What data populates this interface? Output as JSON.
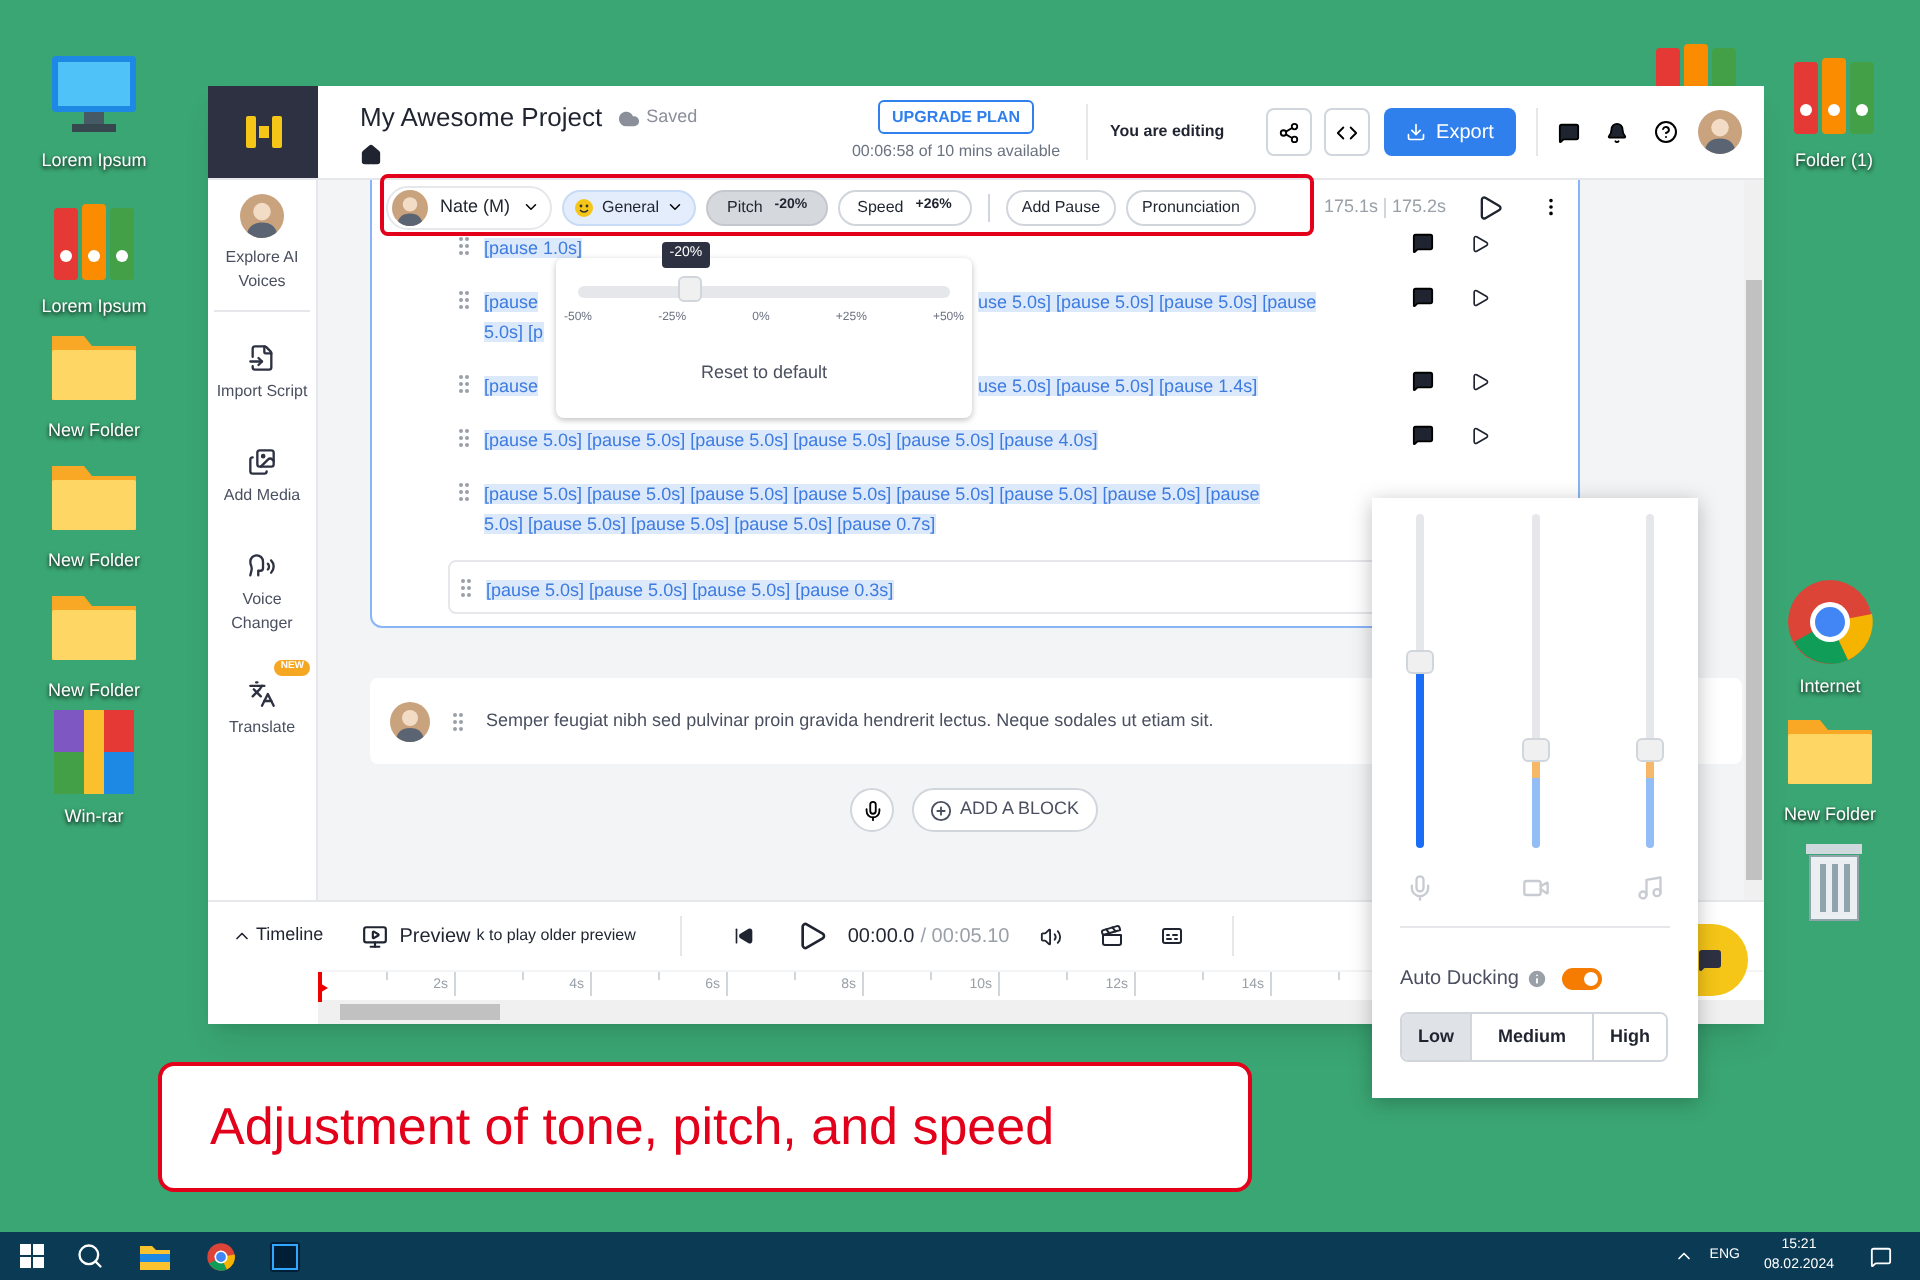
{
  "desktop_icons": [
    {
      "label": "Lorem Ipsum",
      "kind": "computer"
    },
    {
      "label": "Lorem Ipsum",
      "kind": "binders"
    },
    {
      "label": "New Folder",
      "kind": "folder"
    },
    {
      "label": "New Folder",
      "kind": "folder"
    },
    {
      "label": "New Folder",
      "kind": "folder"
    },
    {
      "label": "Win-rar",
      "kind": "archive"
    },
    {
      "kind": "binders"
    },
    {
      "label": "Folder (1)",
      "kind": "binders"
    },
    {
      "label": "Internet",
      "kind": "browser"
    },
    {
      "label": "New Folder",
      "kind": "folder"
    },
    {
      "kind": "trash"
    }
  ],
  "window": {
    "project_title": "My Awesome Project",
    "save_status": "Saved",
    "upgrade_button": "UPGRADE PLAN",
    "usage": "00:06:58 of 10 mins available",
    "editing_status": "You are editing",
    "export_button": "Export"
  },
  "sidebar": {
    "items": [
      {
        "label": "Explore AI Voices",
        "kind": "voices"
      },
      {
        "label": "Import Script",
        "kind": "import"
      },
      {
        "label": "Add Media",
        "kind": "media"
      },
      {
        "label": "Voice Changer",
        "kind": "changer"
      },
      {
        "label": "Translate",
        "kind": "translate",
        "badge": "NEW"
      }
    ]
  },
  "toolbar": {
    "voice": "Nate (M)",
    "style": "General",
    "adjustments": [
      {
        "label": "Pitch",
        "value": "-20%",
        "selected": true
      },
      {
        "label": "Speed",
        "value": "+26%",
        "selected": false
      }
    ],
    "actions": [
      "Add Pause",
      "Pronunciation"
    ],
    "duration": "175.1s",
    "total": "175.2s"
  },
  "pitch_popover": {
    "tooltip": "-20%",
    "level": 0.3,
    "ticks": [
      "-50%",
      "-25%",
      "0%",
      "+25%",
      "+50%"
    ],
    "reset": "Reset to default"
  },
  "rows": [
    {
      "boxed": false,
      "actions": true,
      "lines": [
        [
          "[pause 1.0s]"
        ]
      ]
    },
    {
      "boxed": false,
      "actions": true,
      "lines": [
        [
          "[pause",
          "use 5.0s] [pause 5.0s] [pause 5.0s] [pause"
        ],
        [
          "5.0s] [p"
        ]
      ]
    },
    {
      "boxed": false,
      "actions": true,
      "lines": [
        [
          "[pause",
          "use 5.0s] [pause 5.0s] [pause 1.4s]"
        ]
      ]
    },
    {
      "boxed": false,
      "actions": true,
      "lines": [
        [
          "[pause 5.0s] [pause 5.0s] [pause 5.0s] [pause 5.0s] [pause 5.0s] [pause 4.0s]"
        ]
      ]
    },
    {
      "boxed": false,
      "actions": false,
      "lines": [
        [
          "[pause 5.0s] [pause 5.0s] [pause 5.0s] [pause 5.0s] [pause 5.0s] [pause 5.0s] [pause 5.0s] [pause"
        ],
        [
          "5.0s] [pause 5.0s] [pause 5.0s] [pause 5.0s] [pause 0.7s]"
        ]
      ]
    },
    {
      "boxed": true,
      "actions": false,
      "lines": [
        [
          "[pause 5.0s] [pause 5.0s] [pause 5.0s] [pause 0.3s]"
        ]
      ]
    }
  ],
  "second_block": {
    "text": "Semper feugiat nibh sed pulvinar proin gravida hendrerit lectus. Neque sodales ut etiam sit."
  },
  "add_block": "ADD A BLOCK",
  "player": {
    "timeline": "Timeline",
    "preview": "Preview",
    "preview_hint": "k to play older preview",
    "time": "00:00.0",
    "duration": "/ 00:05.10",
    "ruler": [
      "2s",
      "4s",
      "6s",
      "8s",
      "10s",
      "12s",
      "14s"
    ]
  },
  "mixer": {
    "channels": [
      {
        "kind": "mic",
        "level": 0.56,
        "ducked": false
      },
      {
        "kind": "video",
        "level": 0.28,
        "ducked": true
      },
      {
        "kind": "music",
        "level": 0.28,
        "ducked": true
      }
    ],
    "auto_ducking": {
      "label": "Auto Ducking",
      "on": true
    },
    "levels": [
      {
        "label": "Low",
        "selected": true
      },
      {
        "label": "Medium",
        "selected": false
      },
      {
        "label": "High",
        "selected": false
      }
    ]
  },
  "caption": "Adjustment of tone, pitch, and speed",
  "taskbar": {
    "language": "ENG",
    "time": "15:21",
    "date": "08.02.2024"
  }
}
